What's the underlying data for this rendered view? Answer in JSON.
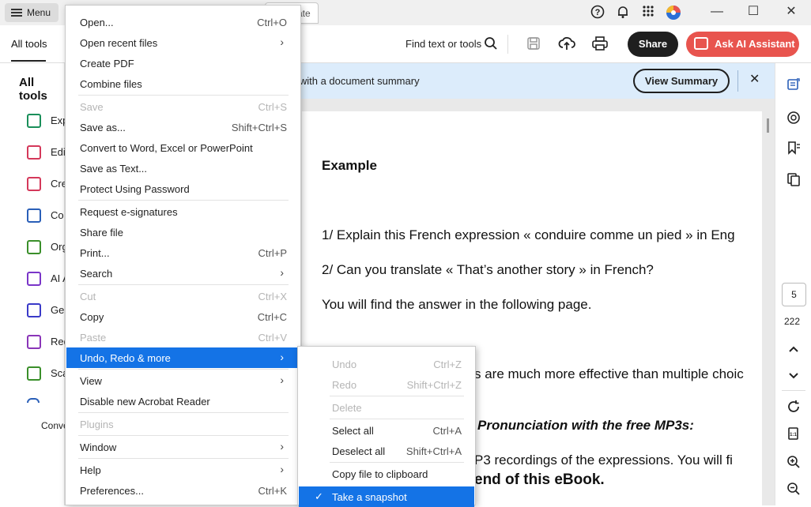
{
  "titlebar": {
    "menu_label": "Menu",
    "doc_tab_partial": "ate",
    "window_controls": [
      "minimize",
      "maximize",
      "close"
    ]
  },
  "toolbar": {
    "all_tools_tab": "All tools",
    "find_text": "Find text or tools",
    "share_label": "Share",
    "ai_label": "Ask AI Assistant"
  },
  "leftpanel": {
    "title": "All tools",
    "tools": [
      {
        "label": "Exp",
        "color": "#1a8f5a"
      },
      {
        "label": "Edi",
        "color": "#d4385a"
      },
      {
        "label": "Cre",
        "color": "#d4385a"
      },
      {
        "label": "Co",
        "color": "#2a5fb8"
      },
      {
        "label": "Org",
        "color": "#3a8f2a"
      },
      {
        "label": "AI A",
        "color": "#7a35c8"
      },
      {
        "label": "Ge",
        "color": "#3a3ac8"
      },
      {
        "label": "Red",
        "color": "#8a35b8"
      },
      {
        "label": "Sca",
        "color": "#3a8f2a"
      }
    ],
    "footer_label": "Conve"
  },
  "banner": {
    "text": "e with a document summary",
    "button_label": "View Summary",
    "close": "✕"
  },
  "document": {
    "lines": [
      "Example",
      "1/ Explain this French expression « conduire comme un pied » in Eng",
      "2/ Can you translate « That’s another story » in French?",
      "You will find the answer in the following page.",
      "s are much more effective than multiple choic",
      "Pronunciation with the free MP3s:",
      "P3 recordings of the expressions. You will fi",
      "end of this eBook."
    ]
  },
  "rightrail": {
    "page_number": "5",
    "page_total": "222"
  },
  "menu": {
    "items": [
      {
        "label": "Open...",
        "shortcut": "Ctrl+O",
        "disabled": false,
        "submenu": false
      },
      {
        "label": "Open recent files",
        "shortcut": "",
        "disabled": false,
        "submenu": true
      },
      {
        "label": "Create PDF",
        "shortcut": "",
        "disabled": false,
        "submenu": false
      },
      {
        "label": "Combine files",
        "shortcut": "",
        "disabled": false,
        "submenu": false
      },
      {
        "label": "Save",
        "shortcut": "Ctrl+S",
        "disabled": true,
        "submenu": false
      },
      {
        "label": "Save as...",
        "shortcut": "Shift+Ctrl+S",
        "disabled": false,
        "submenu": false
      },
      {
        "label": "Convert to Word, Excel or PowerPoint",
        "shortcut": "",
        "disabled": false,
        "submenu": false
      },
      {
        "label": "Save as Text...",
        "shortcut": "",
        "disabled": false,
        "submenu": false
      },
      {
        "label": "Protect Using Password",
        "shortcut": "",
        "disabled": false,
        "submenu": false
      },
      {
        "label": "Request e-signatures",
        "shortcut": "",
        "disabled": false,
        "submenu": false
      },
      {
        "label": "Share file",
        "shortcut": "",
        "disabled": false,
        "submenu": false
      },
      {
        "label": "Print...",
        "shortcut": "Ctrl+P",
        "disabled": false,
        "submenu": false
      },
      {
        "label": "Search",
        "shortcut": "",
        "disabled": false,
        "submenu": true
      },
      {
        "label": "Cut",
        "shortcut": "Ctrl+X",
        "disabled": true,
        "submenu": false
      },
      {
        "label": "Copy",
        "shortcut": "Ctrl+C",
        "disabled": false,
        "submenu": false
      },
      {
        "label": "Paste",
        "shortcut": "Ctrl+V",
        "disabled": true,
        "submenu": false
      },
      {
        "label": "Undo, Redo & more",
        "shortcut": "",
        "disabled": false,
        "submenu": true,
        "highlighted": true
      },
      {
        "label": "View",
        "shortcut": "",
        "disabled": false,
        "submenu": true
      },
      {
        "label": "Disable new Acrobat Reader",
        "shortcut": "",
        "disabled": false,
        "submenu": false
      },
      {
        "label": "Plugins",
        "shortcut": "",
        "disabled": true,
        "submenu": false
      },
      {
        "label": "Window",
        "shortcut": "",
        "disabled": false,
        "submenu": true
      },
      {
        "label": "Help",
        "shortcut": "",
        "disabled": false,
        "submenu": true
      },
      {
        "label": "Preferences...",
        "shortcut": "Ctrl+K",
        "disabled": false,
        "submenu": false
      }
    ]
  },
  "submenu": {
    "items": [
      {
        "label": "Undo",
        "shortcut": "Ctrl+Z",
        "disabled": true
      },
      {
        "label": "Redo",
        "shortcut": "Shift+Ctrl+Z",
        "disabled": true
      },
      {
        "label": "Delete",
        "shortcut": "",
        "disabled": true
      },
      {
        "label": "Select all",
        "shortcut": "Ctrl+A",
        "disabled": false
      },
      {
        "label": "Deselect all",
        "shortcut": "Shift+Ctrl+A",
        "disabled": false
      },
      {
        "label": "Copy file to clipboard",
        "shortcut": "",
        "disabled": false
      },
      {
        "label": "Take a snapshot",
        "shortcut": "",
        "disabled": false,
        "checked": true,
        "highlighted": true
      }
    ]
  },
  "colors": {
    "accent": "#1473e6",
    "ai_button": "#e8544e",
    "banner_bg": "#dcecfb"
  }
}
